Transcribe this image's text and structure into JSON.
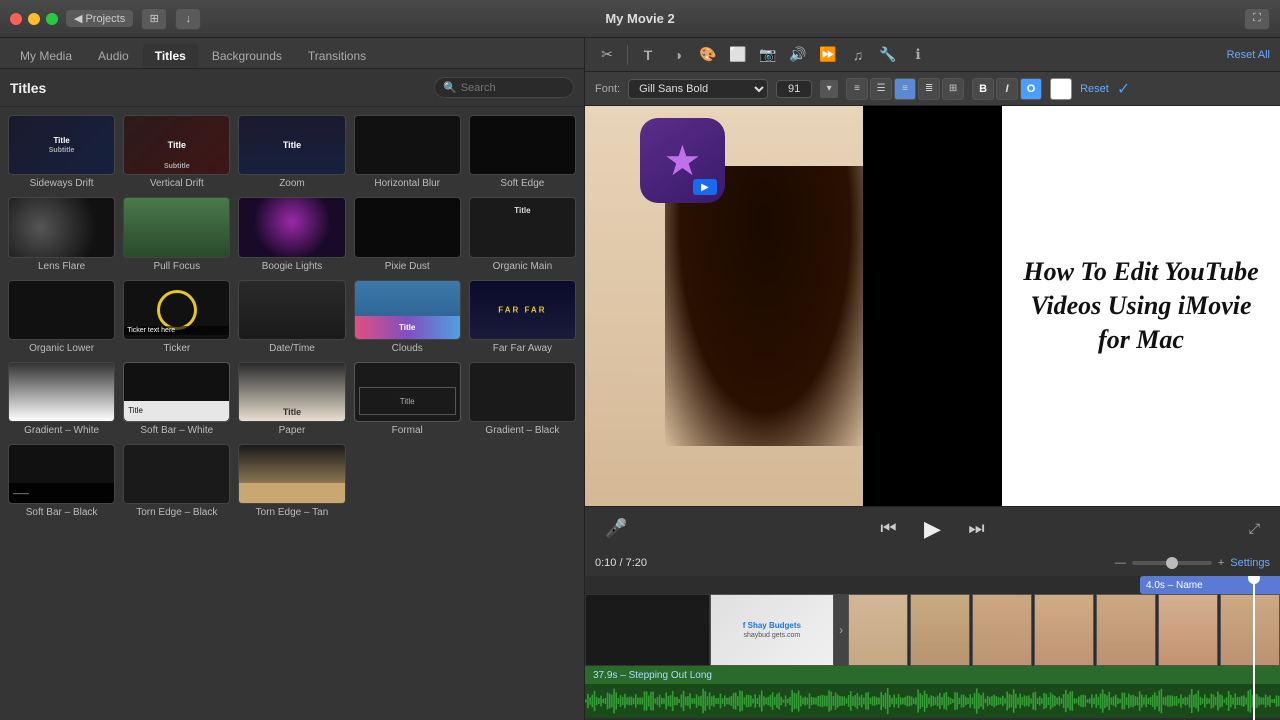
{
  "window": {
    "title": "My Movie 2"
  },
  "nav": {
    "tabs": [
      "My Media",
      "Audio",
      "Titles",
      "Backgrounds",
      "Transitions"
    ],
    "active": "Titles"
  },
  "panel": {
    "title": "Titles",
    "search_placeholder": "Search"
  },
  "toolbar": {
    "reset_all_label": "Reset All",
    "font_label": "Font:",
    "font_value": "Gill Sans Bold",
    "font_size": "91",
    "reset_label": "Reset",
    "bold": "B",
    "italic": "I",
    "outline": "O"
  },
  "titles": [
    {
      "id": "sideways-drift",
      "label": "Sideways Drift",
      "style": "sideways"
    },
    {
      "id": "vertical-drift",
      "label": "Vertical Drift",
      "style": "vertical"
    },
    {
      "id": "zoom",
      "label": "Zoom",
      "style": "zoom"
    },
    {
      "id": "horizontal-blur",
      "label": "Horizontal Blur",
      "style": "hblur"
    },
    {
      "id": "soft-edge",
      "label": "Soft Edge",
      "style": "soft-edge"
    },
    {
      "id": "lens-flare",
      "label": "Lens Flare",
      "style": "lens"
    },
    {
      "id": "pull-focus",
      "label": "Pull Focus",
      "style": "pull"
    },
    {
      "id": "boogie-lights",
      "label": "Boogie Lights",
      "style": "boogie"
    },
    {
      "id": "pixie-dust",
      "label": "Pixie Dust",
      "style": "pixie"
    },
    {
      "id": "organic-main",
      "label": "Organic Main",
      "style": "organic-main"
    },
    {
      "id": "organic-lower",
      "label": "Organic Lower",
      "style": "organic-lower"
    },
    {
      "id": "ticker",
      "label": "Ticker",
      "style": "ticker",
      "highlighted": true
    },
    {
      "id": "datetime",
      "label": "Date/Time",
      "style": "datetime"
    },
    {
      "id": "clouds",
      "label": "Clouds",
      "style": "clouds"
    },
    {
      "id": "far-far-away",
      "label": "Far Far Away",
      "style": "faraway"
    },
    {
      "id": "gradient-white",
      "label": "Gradient – White",
      "style": "gradient-white"
    },
    {
      "id": "soft-bar-white",
      "label": "Soft Bar – White",
      "style": "soft-bar-white"
    },
    {
      "id": "paper",
      "label": "Paper",
      "style": "paper"
    },
    {
      "id": "formal",
      "label": "Formal",
      "style": "formal"
    },
    {
      "id": "gradient-black",
      "label": "Gradient – Black",
      "style": "gradient-black"
    },
    {
      "id": "soft-bar-black",
      "label": "Soft Bar – Black",
      "style": "soft-bar-black"
    },
    {
      "id": "torn-edge-black",
      "label": "Torn Edge – Black",
      "style": "torn-black"
    },
    {
      "id": "torn-edge-tan",
      "label": "Torn Edge – Tan",
      "style": "torn-tan"
    }
  ],
  "preview": {
    "title_text": "How To Edit YouTube Videos Using iMovie for Mac",
    "time_current": "0:10",
    "time_total": "7:20"
  },
  "timeline": {
    "title_clip_label": "4.0s – Name",
    "audio_label": "37.9s – Stepping Out Long",
    "settings_label": "Settings"
  }
}
